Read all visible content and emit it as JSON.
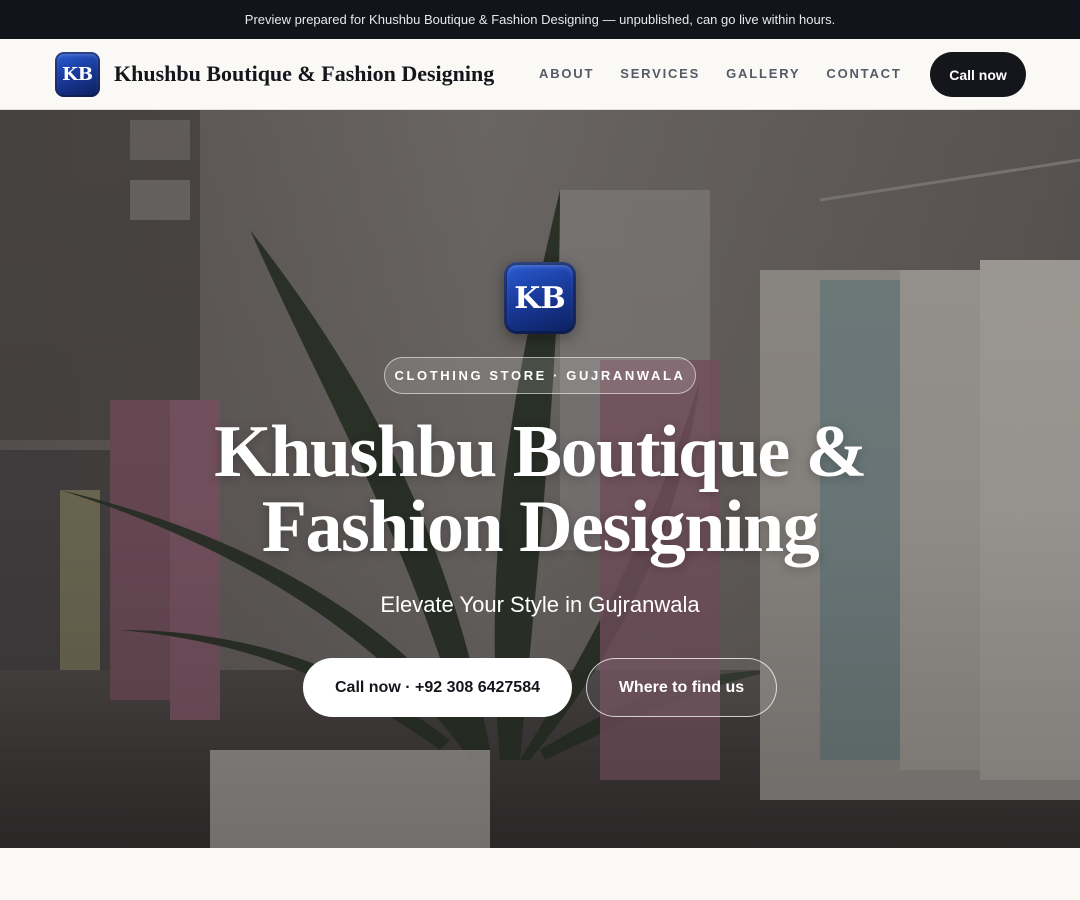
{
  "preview_banner": {
    "text": "Preview prepared for Khushbu Boutique & Fashion Designing — unpublished, can go live within hours."
  },
  "nav": {
    "logo_initials": "KB",
    "brand_name": "Khushbu Boutique & Fashion Designing",
    "links": [
      "ABOUT",
      "SERVICES",
      "GALLERY",
      "CONTACT"
    ],
    "cta_label": "Call now"
  },
  "hero": {
    "logo_initials": "KB",
    "tag": "CLOTHING STORE · GUJRANWALA",
    "title_line1": "Khushbu Boutique &",
    "title_line2": "Fashion Designing",
    "subtitle": "Elevate Your Style in Gujranwala",
    "primary_button": "Call now · +92 308 6427584",
    "secondary_button": "Where to find us",
    "background_image": "boutique-interior-photo"
  },
  "colors": {
    "banner_bg": "#11141a",
    "dark_button": "#14161c",
    "page_bg": "#faf9f6",
    "logo_blue": "#1a3c9e"
  }
}
